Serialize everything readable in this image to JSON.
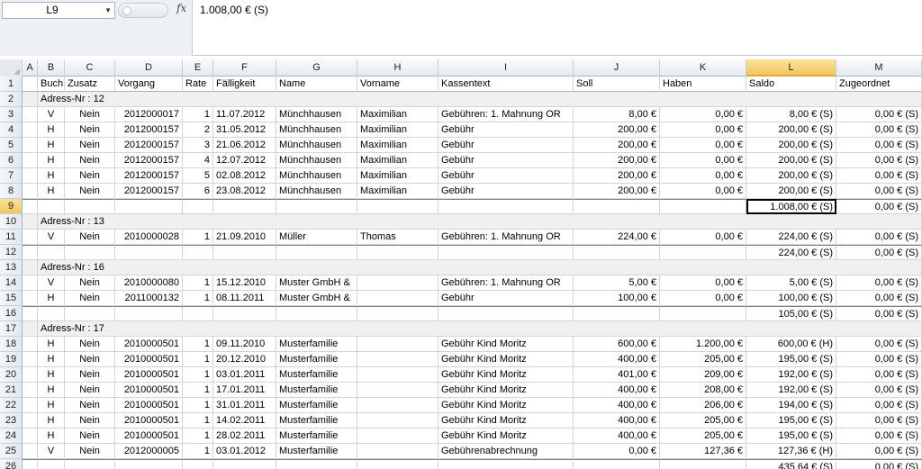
{
  "formula_bar": {
    "name_box": "L9",
    "fx_label": "fx",
    "formula": "1.008,00 € (S)"
  },
  "columns": [
    "A",
    "B",
    "C",
    "D",
    "E",
    "F",
    "G",
    "H",
    "I",
    "J",
    "K",
    "L",
    "M"
  ],
  "selected_column": "L",
  "selected_row": "9",
  "header_row": {
    "num": "1",
    "cells": [
      "",
      "Buch",
      "Zusatz",
      "Vorgang",
      "Rate",
      "Fälligkeit",
      "Name",
      "Vorname",
      "Kassentext",
      "Soll",
      "Haben",
      "Saldo",
      "Zugeordnet"
    ]
  },
  "rows": [
    {
      "num": "2",
      "type": "group",
      "label": "Adress-Nr : 12"
    },
    {
      "num": "3",
      "type": "data",
      "cells": [
        "V",
        "Nein",
        "2012000017",
        "1",
        "11.07.2012",
        "Münchhausen",
        "Maximilian",
        "Gebühren: 1. Mahnung OR",
        "8,00 €",
        "0,00 €",
        "8,00 € (S)",
        "0,00 € (S)"
      ]
    },
    {
      "num": "4",
      "type": "data",
      "cells": [
        "H",
        "Nein",
        "2012000157",
        "2",
        "31.05.2012",
        "Münchhausen",
        "Maximilian",
        "Gebühr",
        "200,00 €",
        "0,00 €",
        "200,00 € (S)",
        "0,00 € (S)"
      ]
    },
    {
      "num": "5",
      "type": "data",
      "cells": [
        "H",
        "Nein",
        "2012000157",
        "3",
        "21.06.2012",
        "Münchhausen",
        "Maximilian",
        "Gebühr",
        "200,00 €",
        "0,00 €",
        "200,00 € (S)",
        "0,00 € (S)"
      ]
    },
    {
      "num": "6",
      "type": "data",
      "cells": [
        "H",
        "Nein",
        "2012000157",
        "4",
        "12.07.2012",
        "Münchhausen",
        "Maximilian",
        "Gebühr",
        "200,00 €",
        "0,00 €",
        "200,00 € (S)",
        "0,00 € (S)"
      ]
    },
    {
      "num": "7",
      "type": "data",
      "cells": [
        "H",
        "Nein",
        "2012000157",
        "5",
        "02.08.2012",
        "Münchhausen",
        "Maximilian",
        "Gebühr",
        "200,00 €",
        "0,00 €",
        "200,00 € (S)",
        "0,00 € (S)"
      ]
    },
    {
      "num": "8",
      "type": "data",
      "cells": [
        "H",
        "Nein",
        "2012000157",
        "6",
        "23.08.2012",
        "Münchhausen",
        "Maximilian",
        "Gebühr",
        "200,00 €",
        "0,00 €",
        "200,00 € (S)",
        "0,00 € (S)"
      ]
    },
    {
      "num": "9",
      "type": "sub",
      "saldo": "1.008,00 € (S)",
      "zugeordnet": "0,00 € (S)"
    },
    {
      "num": "10",
      "type": "group",
      "label": "Adress-Nr : 13"
    },
    {
      "num": "11",
      "type": "data",
      "cells": [
        "V",
        "Nein",
        "2010000028",
        "1",
        "21.09.2010",
        "Müller",
        "Thomas",
        "Gebühren: 1. Mahnung OR",
        "224,00 €",
        "0,00 €",
        "224,00 € (S)",
        "0,00 € (S)"
      ]
    },
    {
      "num": "12",
      "type": "sub",
      "saldo": "224,00 € (S)",
      "zugeordnet": "0,00 € (S)"
    },
    {
      "num": "13",
      "type": "group",
      "label": "Adress-Nr : 16"
    },
    {
      "num": "14",
      "type": "data",
      "cells": [
        "V",
        "Nein",
        "2010000080",
        "1",
        "15.12.2010",
        "Muster GmbH &",
        "",
        "Gebühren: 1. Mahnung OR",
        "5,00 €",
        "0,00 €",
        "5,00 € (S)",
        "0,00 € (S)"
      ]
    },
    {
      "num": "15",
      "type": "data",
      "cells": [
        "H",
        "Nein",
        "2011000132",
        "1",
        "08.11.2011",
        "Muster GmbH &",
        "",
        "Gebühr",
        "100,00 €",
        "0,00 €",
        "100,00 € (S)",
        "0,00 € (S)"
      ]
    },
    {
      "num": "16",
      "type": "sub",
      "saldo": "105,00 € (S)",
      "zugeordnet": "0,00 € (S)"
    },
    {
      "num": "17",
      "type": "group",
      "label": "Adress-Nr : 17"
    },
    {
      "num": "18",
      "type": "data",
      "cells": [
        "H",
        "Nein",
        "2010000501",
        "1",
        "09.11.2010",
        "Musterfamilie",
        "",
        "Gebühr Kind Moritz",
        "600,00 €",
        "1.200,00 €",
        "600,00 € (H)",
        "0,00 € (S)"
      ]
    },
    {
      "num": "19",
      "type": "data",
      "cells": [
        "H",
        "Nein",
        "2010000501",
        "1",
        "20.12.2010",
        "Musterfamilie",
        "",
        "Gebühr Kind Moritz",
        "400,00 €",
        "205,00 €",
        "195,00 € (S)",
        "0,00 € (S)"
      ]
    },
    {
      "num": "20",
      "type": "data",
      "cells": [
        "H",
        "Nein",
        "2010000501",
        "1",
        "03.01.2011",
        "Musterfamilie",
        "",
        "Gebühr Kind Moritz",
        "401,00 €",
        "209,00 €",
        "192,00 € (S)",
        "0,00 € (S)"
      ]
    },
    {
      "num": "21",
      "type": "data",
      "cells": [
        "H",
        "Nein",
        "2010000501",
        "1",
        "17.01.2011",
        "Musterfamilie",
        "",
        "Gebühr Kind Moritz",
        "400,00 €",
        "208,00 €",
        "192,00 € (S)",
        "0,00 € (S)"
      ]
    },
    {
      "num": "22",
      "type": "data",
      "cells": [
        "H",
        "Nein",
        "2010000501",
        "1",
        "31.01.2011",
        "Musterfamilie",
        "",
        "Gebühr Kind Moritz",
        "400,00 €",
        "206,00 €",
        "194,00 € (S)",
        "0,00 € (S)"
      ]
    },
    {
      "num": "23",
      "type": "data",
      "cells": [
        "H",
        "Nein",
        "2010000501",
        "1",
        "14.02.2011",
        "Musterfamilie",
        "",
        "Gebühr Kind Moritz",
        "400,00 €",
        "205,00 €",
        "195,00 € (S)",
        "0,00 € (S)"
      ]
    },
    {
      "num": "24",
      "type": "data",
      "cells": [
        "H",
        "Nein",
        "2010000501",
        "1",
        "28.02.2011",
        "Musterfamilie",
        "",
        "Gebühr Kind Moritz",
        "400,00 €",
        "205,00 €",
        "195,00 € (S)",
        "0,00 € (S)"
      ]
    },
    {
      "num": "25",
      "type": "data",
      "cells": [
        "V",
        "Nein",
        "2012000005",
        "1",
        "03.01.2012",
        "Musterfamilie",
        "",
        "Gebührenabrechnung",
        "0,00 €",
        "127,36 €",
        "127,36 € (H)",
        "0,00 € (S)"
      ]
    },
    {
      "num": "26",
      "type": "sub",
      "saldo": "435,64 € (S)",
      "zugeordnet": "0,00 € (S)"
    }
  ]
}
